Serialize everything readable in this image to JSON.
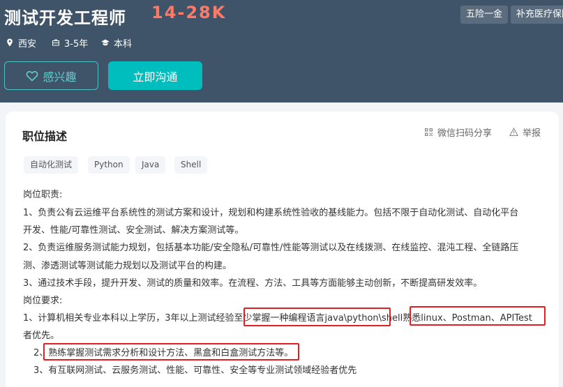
{
  "job": {
    "title": "测试开发工程师",
    "salary": "14-28K",
    "benefits": [
      "五险一金",
      "补充医疗保险"
    ],
    "city": "西安",
    "experience": "3-5年",
    "education": "本科"
  },
  "actions": {
    "interest_label": "感兴趣",
    "chat_label": "立即沟通"
  },
  "description": {
    "section_title": "职位描述",
    "share_label": "微信扫码分享",
    "report_label": "举报",
    "tags": [
      "自动化测试",
      "Python",
      "Java",
      "Shell"
    ],
    "lines": [
      "岗位职责:",
      "1、负责公有云运维平台系统性的测试方案和设计，规划和构建系统性验收的基线能力。包括不限于自动化测试、自动化平台",
      "开发、性能/可靠性测试、安全测试、解决方案测试等。",
      "2、负责运维服务测试能力规划，包括基本功能/安全隐私/可靠性/性能等测试以及在线拨测、在线监控、混沌工程、全链路压",
      "测、渗透测试等测试能力规划以及测试平台的构建。",
      "3、通过技术手段，提升开发、测试的质量和效率。在流程、方法、工具等方面能够主动创新，不断提高研发效率。",
      "岗位要求:",
      "1、计算机相关专业本科以上学历，3年以上测试经验至少掌握一种编程语言java\\python\\shell熟悉linux、Postman、APITest",
      "者优先。",
      "2、熟练掌握测试需求分析和设计方法、黑盒和白盒测试方法等。",
      "3、有互联网测试、云服务测试、性能、可靠性、安全等专业测试领域经验者优先"
    ]
  },
  "colors": {
    "header_bg": "#405469",
    "salary": "#ff7a66",
    "accent": "#00bebd",
    "highlight_box": "#e02020"
  }
}
